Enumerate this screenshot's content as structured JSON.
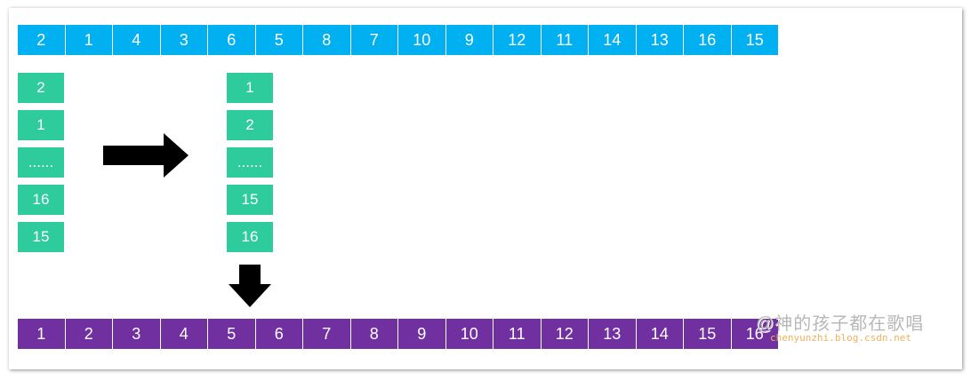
{
  "top_row": [
    "2",
    "1",
    "4",
    "3",
    "6",
    "5",
    "8",
    "7",
    "10",
    "9",
    "12",
    "11",
    "14",
    "13",
    "16",
    "15"
  ],
  "left_column": [
    "2",
    "1",
    "......",
    "16",
    "15"
  ],
  "right_column": [
    "1",
    "2",
    "......",
    "15",
    "16"
  ],
  "bottom_row": [
    "1",
    "2",
    "3",
    "4",
    "5",
    "6",
    "7",
    "8",
    "9",
    "10",
    "11",
    "12",
    "13",
    "14",
    "15",
    "16"
  ],
  "watermark": {
    "text": "@神的孩子都在歌唱",
    "url": "chenyunzhi.blog.csdn.net"
  },
  "colors": {
    "top_row": "#00b0f0",
    "columns": "#2ecc9c",
    "bottom_row": "#7030a0",
    "arrows": "#000000"
  }
}
